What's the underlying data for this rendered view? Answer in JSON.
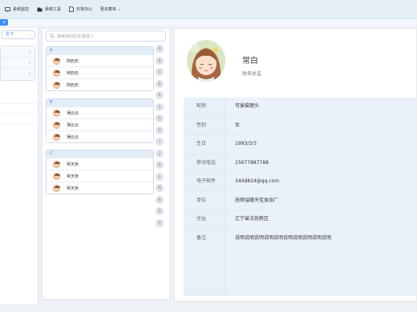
{
  "menubar": {
    "items": [
      {
        "label": "系统监控"
      },
      {
        "label": "系统工具"
      },
      {
        "label": "日常办公"
      },
      {
        "label": "更多菜单 ⌄"
      }
    ]
  },
  "tag": {
    "label": "x"
  },
  "left": {
    "select_value": "全 5",
    "dropdown": "⌄"
  },
  "search": {
    "placeholder": "搜索我的好友/联系人"
  },
  "groups": [
    {
      "letter": "A",
      "contacts": [
        "阿奶奶",
        "阿奶奶",
        "阿奶奶"
      ]
    },
    {
      "letter": "B",
      "contacts": [
        "薄云云",
        "薄云云",
        "薄云云"
      ]
    },
    {
      "letter": "C",
      "contacts": [
        "常天桥",
        "常天桥",
        "常天桥"
      ]
    }
  ],
  "index_letters": [
    "A",
    "B",
    "C",
    "D",
    "E",
    "F",
    "G",
    "H",
    "I",
    "J",
    "K",
    "L",
    "M",
    "N",
    "O",
    "P"
  ],
  "profile": {
    "name": "常白",
    "title": "财务总监",
    "fields": [
      {
        "label": "昵称",
        "value": "可爱猫狸头"
      },
      {
        "label": "性别",
        "value": "女"
      },
      {
        "label": "生日",
        "value": "1993/3/3"
      },
      {
        "label": "移动电话",
        "value": "15677887788"
      },
      {
        "label": "电子邮件",
        "value": "3449824@qq.com"
      },
      {
        "label": "单位",
        "value": "抚顺溢隆天佳食品厂"
      },
      {
        "label": "住址",
        "value": "辽宁省沈抚新区"
      },
      {
        "label": "备注",
        "value": "说明说明说明说明说明说明说明说明说明说明"
      }
    ]
  }
}
